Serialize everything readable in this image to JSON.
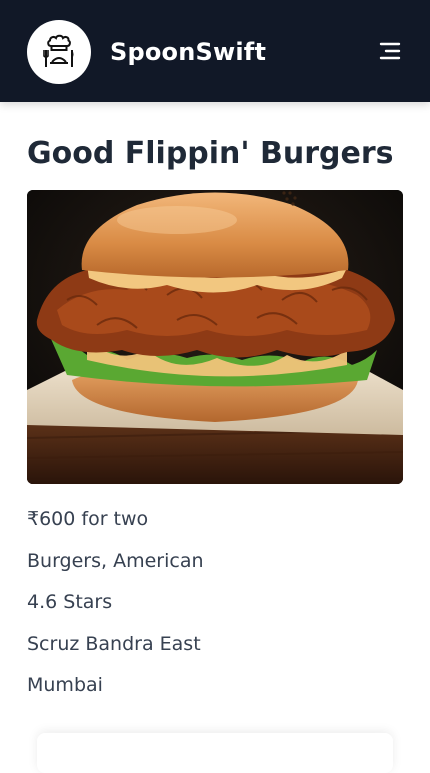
{
  "header": {
    "brand": "SpoonSwift",
    "logo_icon": "chef-logo-icon",
    "menu_icon": "hamburger-menu-icon"
  },
  "restaurant": {
    "name": "Good Flippin' Burgers",
    "image_subject": "burger-photo",
    "price": "₹600 for two",
    "cuisine": "Burgers, American",
    "rating": "4.6 Stars",
    "area": "Scruz Bandra East",
    "city": "Mumbai"
  },
  "colors": {
    "header_bg": "#111827",
    "text_primary": "#1f2937",
    "text_secondary": "#374151"
  }
}
